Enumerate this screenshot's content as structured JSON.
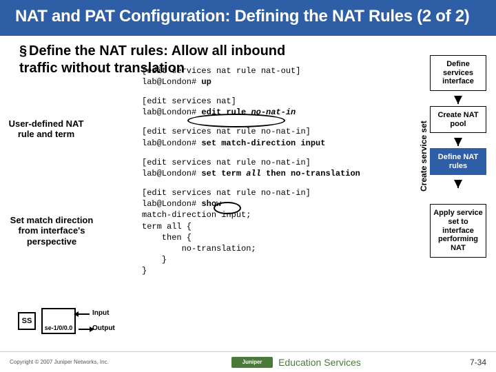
{
  "header": {
    "title": "NAT and PAT Configuration: Defining the NAT Rules (2 of 2)"
  },
  "bullet": {
    "marker": "§",
    "text": "Define the NAT rules: Allow all inbound traffic without translation"
  },
  "annot": {
    "user_defined": "User-defined NAT rule and term",
    "match_dir": "Set match direction from interface's perspective"
  },
  "cli": {
    "l1": "[edit services nat rule nat-out]",
    "l2a": "lab@London# ",
    "l2b": "up",
    "l3": "[edit services nat]",
    "l4a": "lab@London# ",
    "l4b": "edit rule ",
    "l4c": "no-nat-in",
    "l5": "[edit services nat rule no-nat-in]",
    "l6a": "lab@London# ",
    "l6b": "set match-direction input",
    "l7": "[edit services nat rule no-nat-in]",
    "l8a": "lab@London# ",
    "l8b": "set term ",
    "l8c": "all",
    "l8d": " then no-translation",
    "l9": "[edit services nat rule no-nat-in]",
    "l10a": "lab@London# ",
    "l10b": "show",
    "l11": "match-direction input;",
    "l12": "term all {",
    "l13": "    then {",
    "l14": "        no-translation;",
    "l15": "    }",
    "l16": "}"
  },
  "side": {
    "label": "Create service set",
    "s1": "Define services interface",
    "s2": "Create NAT pool",
    "s3": "Define NAT rules",
    "s4": "Apply service set to interface performing NAT"
  },
  "diagram": {
    "ss": "SS",
    "iface": "se-1/0/0.0",
    "in": "Input",
    "out": "Output"
  },
  "footer": {
    "copyright": "Copyright © 2007 Juniper Networks, Inc.",
    "logo": "Juniper",
    "edu": "Education Services",
    "page": "7-34"
  }
}
